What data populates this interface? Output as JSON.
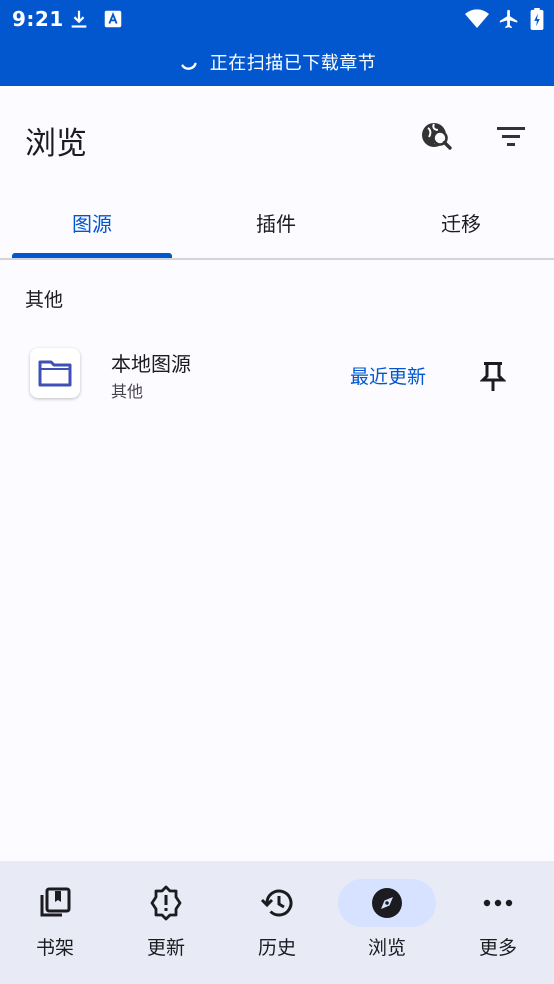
{
  "status_bar": {
    "time": "9:21",
    "icons": [
      "download-icon",
      "a-notification-icon",
      "wifi-icon",
      "airplane-icon",
      "battery-charging-icon"
    ]
  },
  "banner": {
    "text": "正在扫描已下载章节",
    "icon": "spinner-icon"
  },
  "app_bar": {
    "title": "浏览",
    "actions": [
      "global-search-icon",
      "filter-icon"
    ]
  },
  "tabs": [
    {
      "label": "图源",
      "active": true
    },
    {
      "label": "插件",
      "active": false
    },
    {
      "label": "迁移",
      "active": false
    }
  ],
  "section": {
    "header": "其他"
  },
  "source": {
    "name": "本地图源",
    "lang": "其他",
    "latest_label": "最近更新",
    "icon": "folder-icon",
    "pin_icon": "pin-icon"
  },
  "bottom_nav": [
    {
      "label": "书架",
      "icon": "library-icon",
      "active": false
    },
    {
      "label": "更新",
      "icon": "updates-icon",
      "active": false
    },
    {
      "label": "历史",
      "icon": "history-icon",
      "active": false
    },
    {
      "label": "浏览",
      "icon": "compass-icon",
      "active": true
    },
    {
      "label": "更多",
      "icon": "more-icon",
      "active": false
    }
  ],
  "colors": {
    "accent": "#0257ce",
    "nav_bg": "#e8ebf6",
    "nav_active": "#d6e2ff",
    "background": "#fcfbff"
  }
}
